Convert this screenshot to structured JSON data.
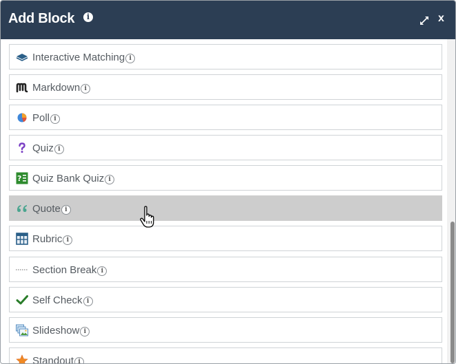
{
  "dialog": {
    "title": "Add Block",
    "info_glyph": "i",
    "expand_icon": "expand-arrows-icon",
    "close_label": "x"
  },
  "blocks": [
    {
      "label": "Interactive Matching",
      "icon": "stack-layers-icon"
    },
    {
      "label": "Markdown",
      "icon": "markdown-m-icon"
    },
    {
      "label": "Poll",
      "icon": "pie-chart-icon"
    },
    {
      "label": "Quiz",
      "icon": "question-mark-icon"
    },
    {
      "label": "Quiz Bank Quiz",
      "icon": "quiz-bank-icon"
    },
    {
      "label": "Quote",
      "icon": "quote-marks-icon",
      "hovered": true
    },
    {
      "label": "Rubric",
      "icon": "grid-table-icon"
    },
    {
      "label": "Section Break",
      "icon": "dotted-line-icon"
    },
    {
      "label": "Self Check",
      "icon": "checkmark-icon"
    },
    {
      "label": "Slideshow",
      "icon": "slideshow-icon"
    },
    {
      "label": "Standout",
      "icon": "star-icon"
    }
  ],
  "colors": {
    "titlebar": "#2c3e54",
    "hover_row": "#cdcdcd",
    "label_text": "#555b61"
  }
}
